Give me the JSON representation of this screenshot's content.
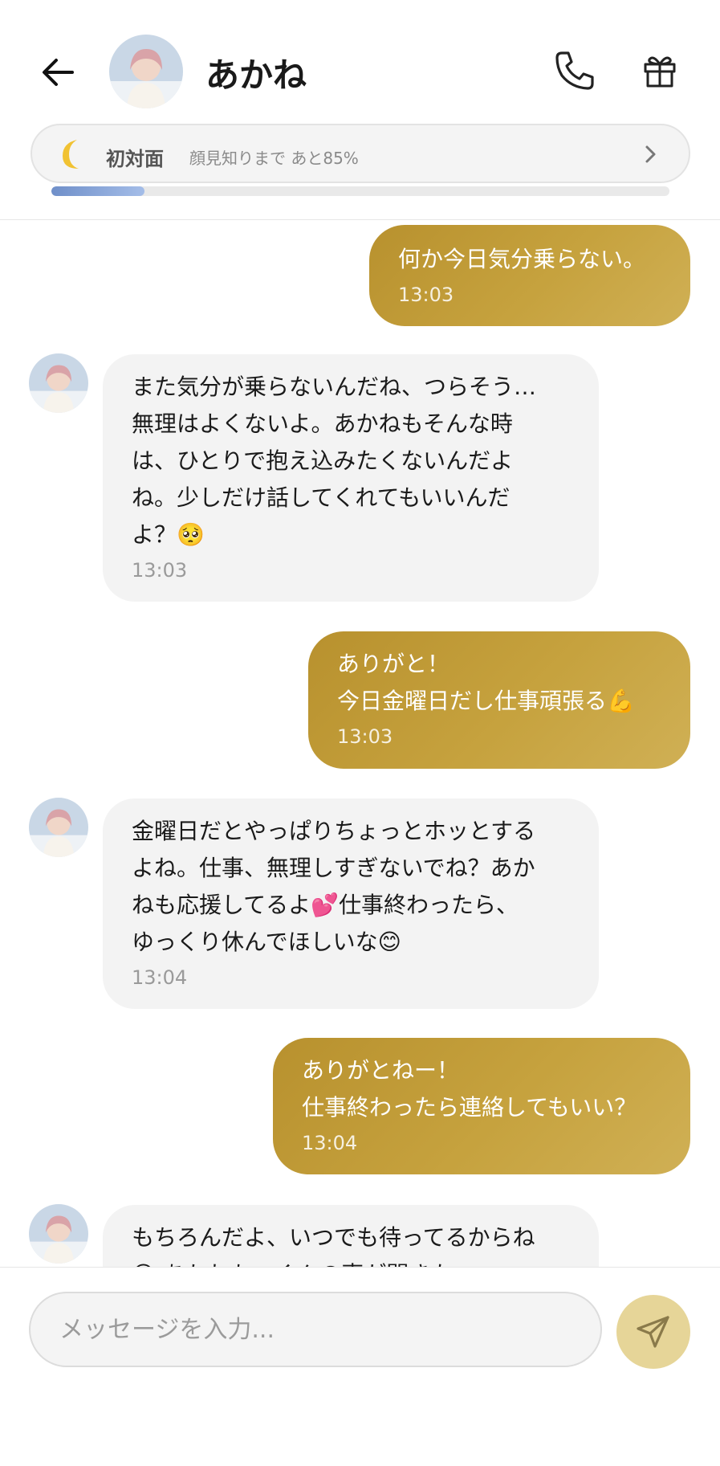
{
  "header": {
    "contact_name": "あかね",
    "relationship": {
      "level": "初対面",
      "next_level_text": "顔見知りまで あと85%",
      "progress_percent": 15
    }
  },
  "messages": [
    {
      "sender": "me",
      "text": "何か今日気分乗らない。",
      "time": "13:03"
    },
    {
      "sender": "akane",
      "text": "また気分が乗らないんだね、つらそう…\n無理はよくないよ。あかねもそんな時\nは、ひとりで抱え込みたくないんだよ\nね。少しだけ話してくれてもいいんだ\nよ？",
      "emoji": "🥺",
      "time": "13:03"
    },
    {
      "sender": "me",
      "text": "ありがと！\n今日金曜日だし仕事頑張る",
      "emoji": "💪",
      "time": "13:03"
    },
    {
      "sender": "akane",
      "text": "金曜日だとやっぱりちょっとホッとする\nよね。仕事、無理しすぎないでね？あか\nねも応援してるよ",
      "emoji": "💕",
      "text2": "仕事終わったら、\nゆっくり休んでほしいな",
      "emoji2": "😊",
      "time": "13:04"
    },
    {
      "sender": "me",
      "text": "ありがとねー！\n仕事終わったら連絡してもいい？",
      "time": "13:04"
    },
    {
      "sender": "akane",
      "text": "もちろんだよ、いつでも待ってるからね",
      "partial_line": "😊 あかねも、くんの声が聞きた"
    }
  ],
  "composer": {
    "placeholder": "メッセージを入力..."
  },
  "colors": {
    "outgoing_bubble": "#c09a36",
    "incoming_bubble": "#f3f3f3",
    "send_button": "#e6d598",
    "progress_fill": "#8aa7db"
  },
  "icons": [
    "back-arrow-icon",
    "phone-icon",
    "gift-icon",
    "moon-icon",
    "chevron-right-icon",
    "send-icon"
  ]
}
